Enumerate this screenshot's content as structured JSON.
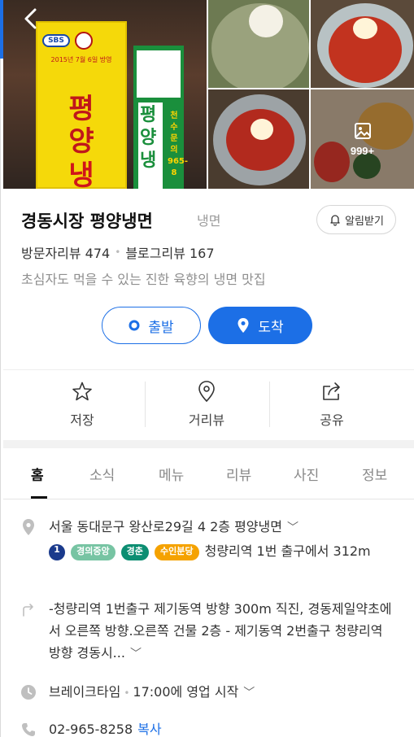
{
  "restaurant": {
    "name": "경동시장 평양냉면",
    "category": "냉면",
    "alarm_label": "알림받기",
    "visitor_reviews": "방문자리뷰 474",
    "blog_reviews": "블로그리뷰 167",
    "tagline": "초심자도 먹을 수 있는 진한 육향의 냉면 맛집"
  },
  "photos": {
    "more_count": "999+",
    "sign": {
      "brand": "SBS",
      "date_text": "2015년 7월 6일 방영",
      "chars": [
        "평",
        "양",
        "냉"
      ],
      "green_chars": [
        "평",
        "양",
        "냉"
      ],
      "green_number": "천수문의 965-8"
    }
  },
  "buttons": {
    "start_label": "출발",
    "arrive_label": "도착"
  },
  "actions": [
    {
      "label": "저장",
      "icon": "star-icon"
    },
    {
      "label": "거리뷰",
      "icon": "location-pin-icon"
    },
    {
      "label": "공유",
      "icon": "share-icon"
    }
  ],
  "tabs": [
    "홈",
    "소식",
    "메뉴",
    "리뷰",
    "사진",
    "정보"
  ],
  "active_tab": "홈",
  "details": {
    "address": "서울 동대문구 왕산로29길 4 2층 평양냉면",
    "subway": {
      "line_number": "1",
      "line_badges": [
        "경의중앙",
        "경춘",
        "수인분당"
      ],
      "text": "청량리역 1번 출구에서 312m"
    },
    "directions": "-청량리역 1번출구 제기동역 방향 300m 직진, 경동제일약초에서 오른쪽 방향.오른쪽 건물 2층 - 제기동역 2번출구 청량리역 방향 경동시...",
    "hours_status": "브레이크타임",
    "hours_text": "17:00에 영업 시작",
    "phone": "02-965-8258",
    "copy_label": "복사"
  },
  "colors": {
    "accent": "#1c6fe6",
    "line1": "#1a3a8c",
    "gyeongui": "#77c4a3",
    "gyeongchun": "#0c8e72",
    "suin_bundang": "#f5a200"
  }
}
